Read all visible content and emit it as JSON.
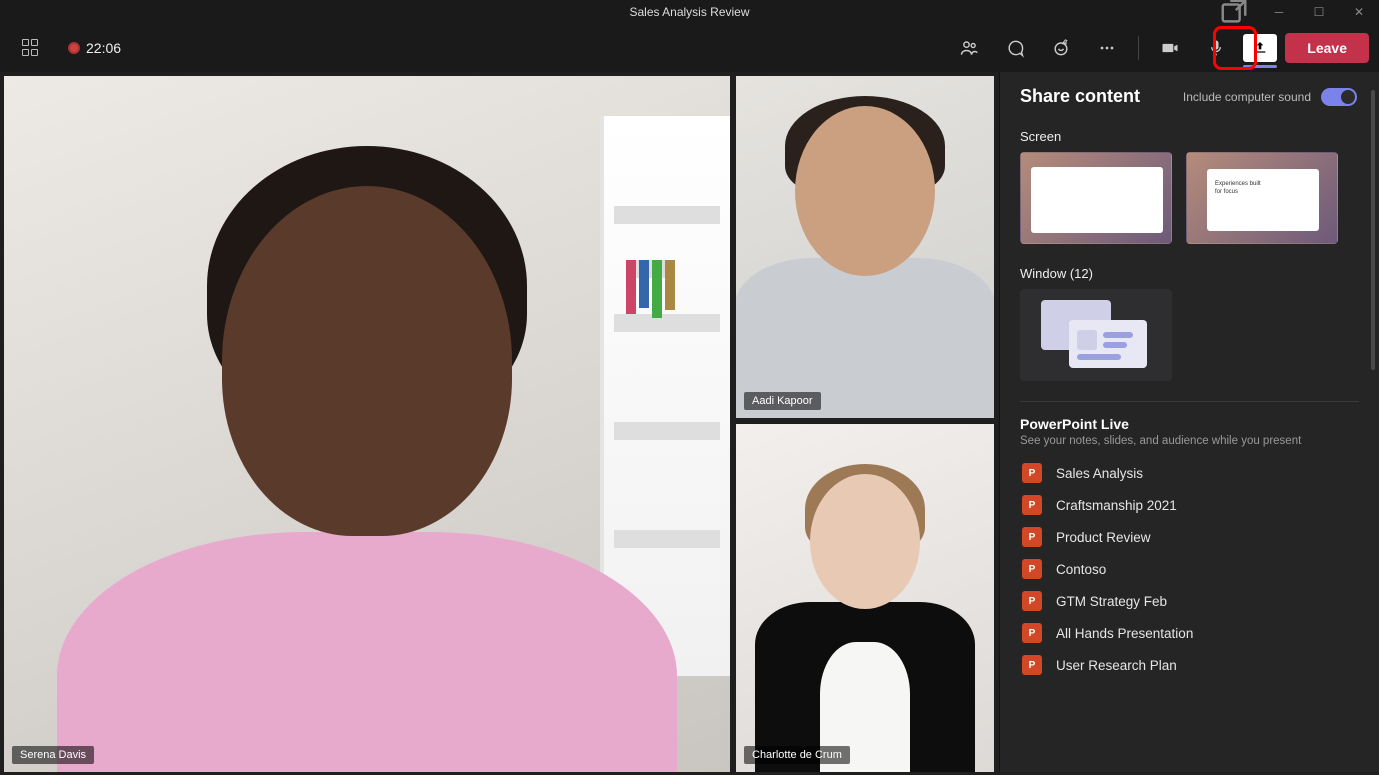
{
  "window": {
    "title": "Sales Analysis Review"
  },
  "toolbar": {
    "timer": "22:06",
    "leave_label": "Leave"
  },
  "participants": {
    "main": "Serena Davis",
    "a": "Aadi Kapoor",
    "b": "Charlotte de Crum"
  },
  "share": {
    "title": "Share content",
    "include_sound_label": "Include computer sound",
    "screen_label": "Screen",
    "window_label": "Window (12)",
    "ppl_title": "PowerPoint Live",
    "ppl_sub": "See your notes, slides, and audience while you present",
    "files": [
      "Sales Analysis",
      "Craftsmanship 2021",
      "Product Review",
      "Contoso",
      "GTM Strategy Feb",
      "All Hands Presentation",
      "User Research Plan"
    ],
    "thumb2_text": "Experiences built for focus"
  }
}
